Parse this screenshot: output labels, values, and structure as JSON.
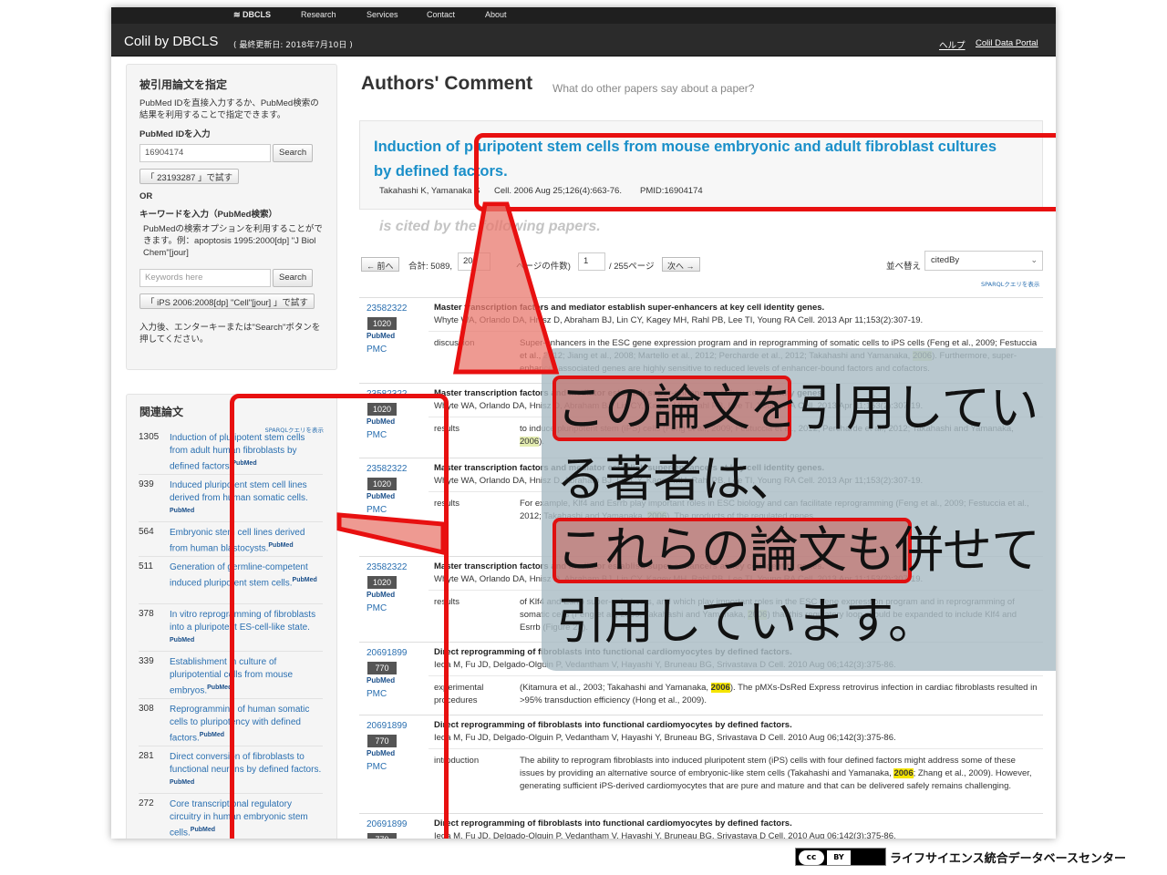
{
  "nav": {
    "dbcls": "DBCLS",
    "items": [
      "Research",
      "Services",
      "Contact",
      "About"
    ]
  },
  "appbar": {
    "brand": "Colil by DBCLS",
    "updated": "( 最終更新日: 2018年7月10日 )",
    "help": "ヘルプ",
    "portal": "Colil Data Portal"
  },
  "search": {
    "title": "被引用論文を指定",
    "desc": "PubMed IDを直接入力するか、PubMed検索の結果を利用することで指定できます。",
    "pmid_label": "PubMed IDを入力",
    "pmid_value": "16904174",
    "search_btn": "Search",
    "try_btn": "「 23193287 」で試す",
    "or": "OR",
    "keyword_label": "キーワードを入力（PubMed検索）",
    "keyword_desc": "PubMedの検索オプションを利用することができます。例：apoptosis 1995:2000[dp] \"J Biol Chem\"[jour]",
    "keyword_placeholder": "Keywords here",
    "search_btn2": "Search",
    "try_btn2": "「 iPS 2006:2008[dp] \"Cell\"[jour] 」で試す",
    "hint": "入力後、エンターキーまたは\"Search\"ボタンを押してください。"
  },
  "related": {
    "title": "関連論文",
    "sparql": "SPARQLクエリを表示",
    "pubmed_label": "PubMed",
    "items": [
      {
        "count": "1305",
        "title": "Induction of pluripotent stem cells from adult human fibroblasts by defined factors."
      },
      {
        "count": "939",
        "title": "Induced pluripotent stem cell lines derived from human somatic cells."
      },
      {
        "count": "564",
        "title": "Embryonic stem cell lines derived from human blastocysts."
      },
      {
        "count": "511",
        "title": "Generation of germline-competent induced pluripotent stem cells."
      },
      {
        "count": "378",
        "title": "In vitro reprogramming of fibroblasts into a pluripotent ES-cell-like state."
      },
      {
        "count": "339",
        "title": "Establishment in culture of pluripotential cells from mouse embryos."
      },
      {
        "count": "308",
        "title": "Reprogramming of human somatic cells to pluripotency with defined factors."
      },
      {
        "count": "281",
        "title": "Direct conversion of fibroblasts to functional neurons by defined factors."
      },
      {
        "count": "272",
        "title": "Core transcriptional regulatory circuitry in human embryonic stem cells."
      }
    ]
  },
  "main": {
    "heading": "Authors' Comment",
    "subheading": "What do other papers say about a paper?",
    "paper_title": "Induction of pluripotent stem cells from mouse embryonic and adult fibroblast cultures by defined factors.",
    "paper_authors": "Takahashi K, Yamanaka S",
    "paper_journal": "Cell. 2006 Aug 25;126(4):663-76.",
    "paper_pmid": "PMID:16904174",
    "cited_by": "is cited by the following papers."
  },
  "pager": {
    "prev": "← 前へ",
    "total": "合計: 5089,",
    "per_page": "20",
    "per_page_label": "ページの件数)",
    "page": "1",
    "pages": "/ 255ページ",
    "next": "次へ →",
    "sort_label": "並べ替え",
    "sort_value": "citedBy",
    "sparql": "SPARQLクエリを表示"
  },
  "rows": [
    {
      "pmid": "23582322",
      "badge": "1020",
      "pubmed": "PubMed",
      "pmc": "PMC",
      "title": "Master transcription factors and mediator establish super-enhancers at key cell identity genes.",
      "authors": "Whyte WA, Orlando DA, Hnisz D, Abraham BJ, Lin CY, Kagey MH, Rahl PB, Lee TI, Young RA    Cell. 2013 Apr 11;153(2):307-19.",
      "section": "discussion",
      "ctx_pre": "Super-enhancers in the ESC gene expression program and in reprogramming of somatic cells to iPS cells (Feng et al., 2009; Festuccia et al., 2012; Jiang et al., 2008; Martello et al., 2012; Percharde et al., 2012; Takahashi and Yamanaka, ",
      "ctx_year": "2006",
      "ctx_post": "). Furthermore, super-enhancer associated genes are highly sensitive to reduced levels of enhancer-bound factors and cofactors."
    },
    {
      "pmid": "23582322",
      "badge": "1020",
      "pubmed": "PubMed",
      "pmc": "PMC",
      "title": "Master transcription factors and mediator establish super-enhancers at key cell identity genes.",
      "authors": "Whyte WA, Orlando DA, Hnisz D, Abraham BJ, Lin CY, Kagey MH, Rahl PB, Lee TI, Young RA    Cell. 2013 Apr 11;153(2):307-19.",
      "section": "results",
      "ctx_pre": "to induce pluripotent stem (iPS) cells (Feng et al., 2009; Festuccia et al., 2012; Percharde et al., 2012; Takahashi and Yamanaka, ",
      "ctx_year": "2006",
      "ctx_post": ")."
    },
    {
      "pmid": "23582322",
      "badge": "1020",
      "pubmed": "PubMed",
      "pmc": "PMC",
      "title": "Master transcription factors and mediator establish super-enhancers at key cell identity genes.",
      "authors": "Whyte WA, Orlando DA, Hnisz D, Abraham BJ, Lin CY, Kagey MH, Rahl PB, Lee TI, Young RA    Cell. 2013 Apr 11;153(2):307-19.",
      "section": "results",
      "ctx_pre": "For example, Klf4 and Esrrb play important roles in ESC biology and can facilitate reprogramming (Feng et al., 2009; Festuccia et al., 2012; Takahashi and Yamanaka, ",
      "ctx_year": "2006",
      "ctx_post": "). The products of the regulated genes..."
    },
    {
      "pmid": "23582322",
      "badge": "1020",
      "pubmed": "PubMed",
      "pmc": "PMC",
      "title": "Master transcription factors and mediator establish super-enhancers at key cell identity genes.",
      "authors": "Whyte WA, Orlando DA, Hnisz D, Abraham BJ, Lin CY, Kagey MH, Rahl PB, Lee TI, Young RA    Cell. 2013 Apr 11;153(2):307-19.",
      "section": "results",
      "ctx_pre": "of Klf4 and Esrrb super-enhancers, and which play important roles in the ESC gene expression program and in reprogramming of somatic cells (Feng et al., 2009; Takahashi and Yamanaka, ",
      "ctx_year": "2006",
      "ctx_post": ") that this regulatory loop should be expanded to include Klf4 and Esrrb (Figure 2F)."
    },
    {
      "pmid": "20691899",
      "badge": "770",
      "pubmed": "PubMed",
      "pmc": "PMC",
      "title": "Direct reprogramming of fibroblasts into functional cardiomyocytes by defined factors.",
      "authors": "Ieda M, Fu JD, Delgado-Olguin P, Vedantham V, Hayashi Y, Bruneau BG, Srivastava D    Cell. 2010 Aug 06;142(3):375-86.",
      "section": "experimental procedures",
      "ctx_pre": "(Kitamura et al., 2003; Takahashi and Yamanaka, ",
      "ctx_year": "2006",
      "ctx_post": "). The pMXs-DsRed Express retrovirus infection in cardiac fibroblasts resulted in >95% transduction efficiency (Hong et al., 2009)."
    },
    {
      "pmid": "20691899",
      "badge": "770",
      "pubmed": "PubMed",
      "pmc": "PMC",
      "title": "Direct reprogramming of fibroblasts into functional cardiomyocytes by defined factors.",
      "authors": "Ieda M, Fu JD, Delgado-Olguin P, Vedantham V, Hayashi Y, Bruneau BG, Srivastava D    Cell. 2010 Aug 06;142(3):375-86.",
      "section": "introduction",
      "ctx_pre": "The ability to reprogram fibroblasts into induced pluripotent stem (iPS) cells with four defined factors might address some of these issues by providing an alternative source of embryonic-like stem cells (Takahashi and Yamanaka, ",
      "ctx_year": "2006",
      "ctx_post": "; Zhang et al., 2009). However, generating sufficient iPS-derived cardiomyocytes that are pure and mature and that can be delivered safely remains challenging."
    },
    {
      "pmid": "20691899",
      "badge": "770",
      "pubmed": "PubMed",
      "pmc": "",
      "title": "Direct reprogramming of fibroblasts into functional cardiomyocytes by defined factors.",
      "authors": "Ieda M, Fu JD, Delgado-Olguin P, Vedantham V, Hayashi Y, Bruneau BG, Srivastava D    Cell. 2010 Aug 06;142(3):375-86.",
      "section": "",
      "ctx_pre": "",
      "ctx_year": "",
      "ctx_post": ""
    }
  ],
  "overlay": {
    "line1a": "この論文",
    "line1b": "を引用してい",
    "line2": "る著者は、",
    "line3a": "これらの論文",
    "line3b": "も併せて",
    "line4": "引用しています。"
  },
  "footer": {
    "cc": "cc",
    "by": "BY",
    "org": "ライフサイエンス統合データベースセンター"
  },
  "colors": {
    "accent_red": "#e81010",
    "link_blue": "#2a6fb0",
    "title_blue": "#1a8fc9",
    "highlight_yellow": "#f5e500"
  }
}
